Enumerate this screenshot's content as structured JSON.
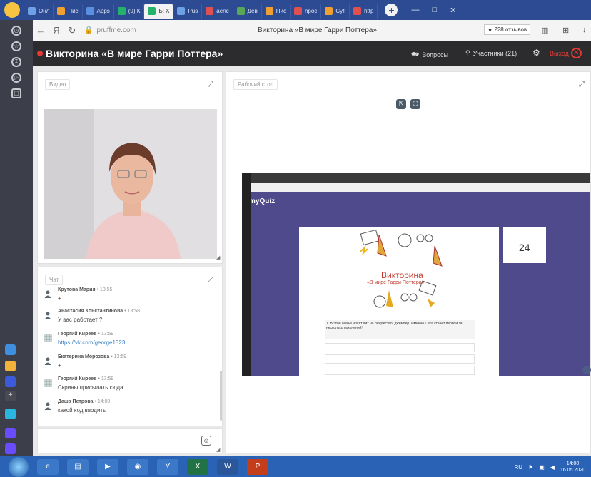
{
  "browser": {
    "tabs": [
      {
        "label": "Онл",
        "color": "#6ea0e8"
      },
      {
        "label": "Пис",
        "color": "#f0a030"
      },
      {
        "label": "Apps",
        "color": "#5b8fe0"
      },
      {
        "label": "(9) К",
        "color": "#24b36a"
      },
      {
        "label": "Б: X",
        "color": "#24b36a",
        "active": true
      },
      {
        "label": "Pus",
        "color": "#6ea0e8"
      },
      {
        "label": "aeric",
        "color": "#e05050"
      },
      {
        "label": "Дев",
        "color": "#58a858"
      },
      {
        "label": "Пис",
        "color": "#f0a030"
      },
      {
        "label": "npoc",
        "color": "#e05050"
      },
      {
        "label": "Cyfi",
        "color": "#f0a030"
      },
      {
        "label": "http",
        "color": "#e05050"
      }
    ],
    "url": "pruffme.com",
    "page_title": "Викторина «В мире Гарри Поттера»",
    "reviews": "★ 228 отзывов"
  },
  "header": {
    "title": "Викторина «В мире Гарри Поттера»",
    "questions": "Вопросы",
    "participants": "Участники (21)",
    "exit": "Выход"
  },
  "video": {
    "label": "Видео"
  },
  "chat": {
    "label": "Чат",
    "messages": [
      {
        "name": "Крутова Мария",
        "time": "13:55",
        "text": "+",
        "avatar": "person"
      },
      {
        "name": "Анастасия Константинова",
        "time": "13:58",
        "text": "У вас работает ?",
        "avatar": "person"
      },
      {
        "name": "Георгий Киреев",
        "time": "13:59",
        "text": "https://vk.com/george1323",
        "avatar": "pattern",
        "link": true
      },
      {
        "name": "Екатерина Морозова",
        "time": "13:59",
        "text": "+",
        "avatar": "person"
      },
      {
        "name": "Георгий Киреев",
        "time": "13:59",
        "text": "Скрины присылать сюда",
        "avatar": "pattern"
      },
      {
        "name": "Даша Петрова",
        "time": "14:00",
        "text": "какой код вводить",
        "avatar": "person"
      }
    ]
  },
  "desk": {
    "label": "Рабочий стол",
    "shared": {
      "logo": "myQuiz",
      "timer": "24",
      "quiz_title": "Викторина",
      "quiz_subtitle": "«В мире Гарри Поттера»",
      "question": "1. В этой семье носят яйт на рождество, джемпер. Именно Сета станет первой за несколько поколений!"
    }
  },
  "taskbar": {
    "lang": "RU",
    "time": "14:00",
    "date": "16.05.2020"
  },
  "icons": {
    "questions": "speech-bubbles-icon",
    "participants": "person-icon",
    "settings": "gear-icon",
    "exit": "close-circle-icon"
  }
}
